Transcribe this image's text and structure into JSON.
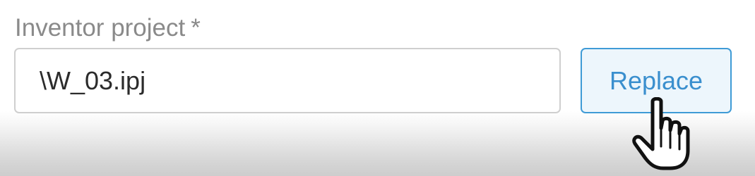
{
  "field": {
    "label": "Inventor project",
    "required_marker": "*",
    "value": "\\W_03.ipj"
  },
  "actions": {
    "replace_label": "Replace"
  },
  "cursor": {
    "icon": "hand-pointer-icon"
  },
  "colors": {
    "label_text": "#8a8a8a",
    "input_border": "#cfcfcf",
    "button_border": "#3f9bd6",
    "button_background": "#edf6fc",
    "button_text": "#3a8fce"
  }
}
